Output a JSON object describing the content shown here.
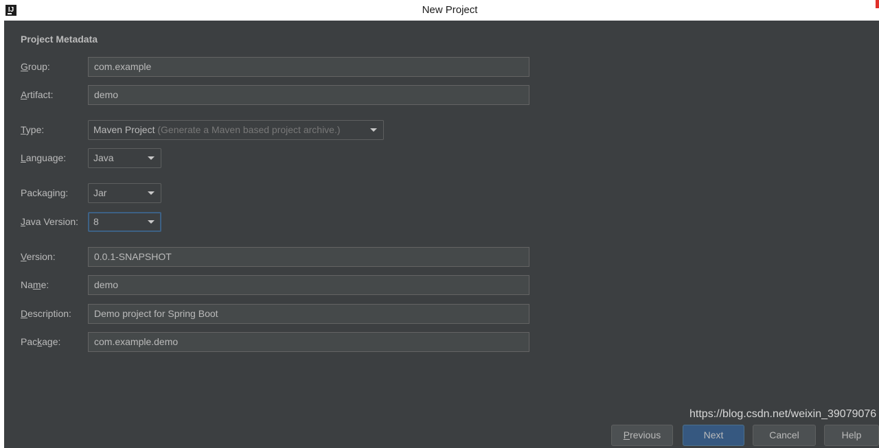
{
  "window": {
    "title": "New Project",
    "app_icon": "intellij-idea-icon",
    "app_icon_text": "IJ"
  },
  "section": {
    "title": "Project Metadata"
  },
  "fields": {
    "group": {
      "label_mnemonic": "G",
      "label_rest": "roup:",
      "value": "com.example"
    },
    "artifact": {
      "label_mnemonic": "A",
      "label_rest": "rtifact:",
      "value": "demo"
    },
    "version": {
      "label_mnemonic": "V",
      "label_rest": "ersion:",
      "value": "0.0.1-SNAPSHOT"
    },
    "name": {
      "label_pre": "Na",
      "label_mnemonic": "m",
      "label_rest": "e:",
      "value": "demo"
    },
    "description": {
      "label_mnemonic": "D",
      "label_rest": "escription:",
      "value": "Demo project for Spring Boot"
    },
    "package": {
      "label_pre": "Pac",
      "label_mnemonic": "k",
      "label_rest": "age:",
      "value": "com.example.demo"
    }
  },
  "selects": {
    "type": {
      "label_mnemonic": "T",
      "label_rest": "ype:",
      "value": "Maven Project",
      "hint": "(Generate a Maven based project archive.)"
    },
    "language": {
      "label_mnemonic": "L",
      "label_rest": "anguage:",
      "value": "Java"
    },
    "packaging": {
      "label": "Packaging:",
      "value": "Jar"
    },
    "java_version": {
      "label_mnemonic": "J",
      "label_rest": "ava Version:",
      "value": "8"
    }
  },
  "buttons": {
    "previous": {
      "mnemonic": "P",
      "rest": "revious"
    },
    "next": {
      "label": "Next"
    },
    "cancel": {
      "label": "Cancel"
    },
    "help": {
      "label": "Help"
    }
  },
  "watermark": "https://blog.csdn.net/weixin_39079076",
  "colors": {
    "dialog_bg": "#3c3f41",
    "field_bg": "#45494a",
    "text": "#bbbbbb",
    "focus_border": "#3d6185",
    "primary_button": "#365880"
  }
}
